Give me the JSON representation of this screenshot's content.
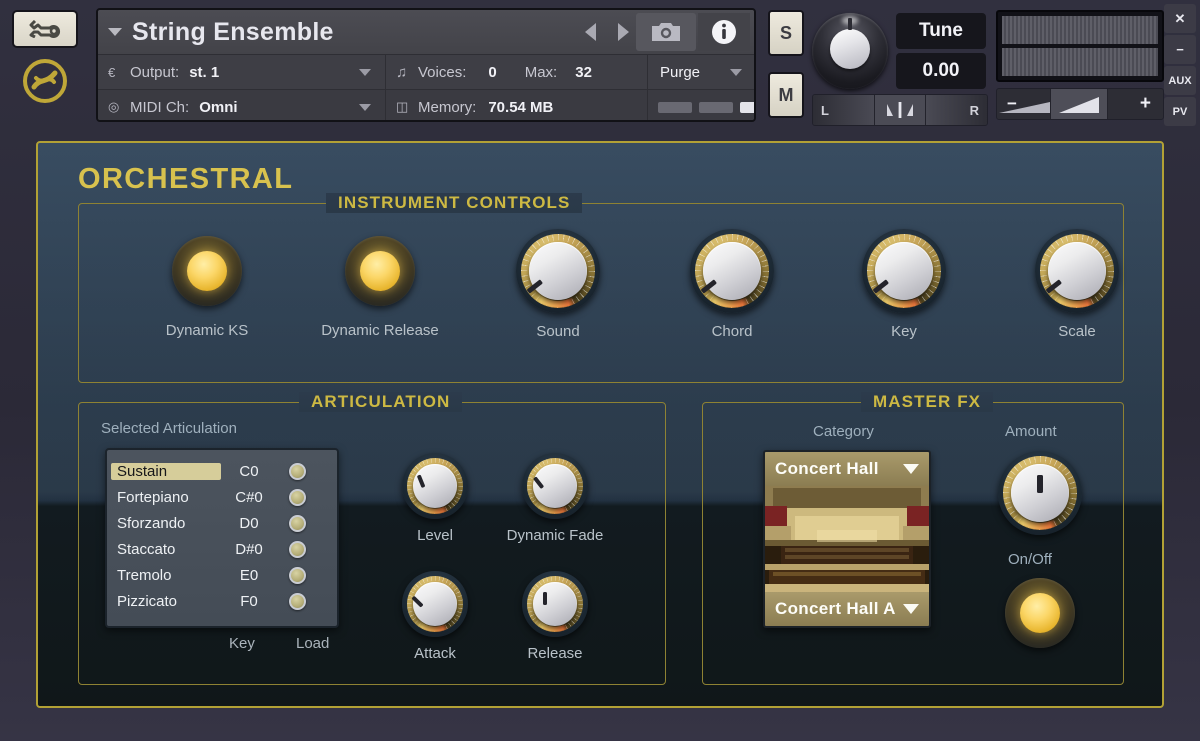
{
  "header": {
    "wrench_icon": "wrench-icon",
    "logo_icon": "native-instruments-logo",
    "instrument_name": "String Ensemble",
    "output_label": "Output:",
    "output_value": "st. 1",
    "midi_label": "MIDI Ch:",
    "midi_value": "Omni",
    "voices_label": "Voices:",
    "voices_value": "0",
    "max_label": "Max:",
    "max_value": "32",
    "memory_label": "Memory:",
    "memory_value": "70.54 MB",
    "purge_label": "Purge",
    "snapshot_icon": "camera-icon",
    "info_icon": "info-icon",
    "prev_icon": "prev-arrow-icon",
    "next_icon": "next-arrow-icon",
    "solo_label": "S",
    "mute_label": "M",
    "tune_label": "Tune",
    "tune_value": "0.00",
    "pan_left": "L",
    "pan_right": "R",
    "vol_minus": "−",
    "vol_plus": "+",
    "edge_buttons": [
      {
        "label": "✕",
        "name": "close-button"
      },
      {
        "label": "−",
        "name": "minimize-button"
      },
      {
        "label": "AUX",
        "name": "aux-button"
      },
      {
        "label": "PV",
        "name": "pv-button"
      }
    ]
  },
  "panel": {
    "brand": "ORCHESTRAL",
    "instrument_controls": {
      "title": "INSTRUMENT CONTROLS",
      "toggles": [
        {
          "label": "Dynamic KS",
          "on": true
        },
        {
          "label": "Dynamic Release",
          "on": true
        }
      ],
      "knobs": [
        {
          "label": "Sound",
          "angle": -128
        },
        {
          "label": "Chord",
          "angle": -128
        },
        {
          "label": "Key",
          "angle": -128
        },
        {
          "label": "Scale",
          "angle": -128
        }
      ]
    },
    "articulation": {
      "title": "ARTICULATION",
      "subtitle": "Selected Articulation",
      "col_key": "Key",
      "col_load": "Load",
      "items": [
        {
          "name": "Sustain",
          "key": "C0",
          "selected": true,
          "loaded": true
        },
        {
          "name": "Fortepiano",
          "key": "C#0",
          "selected": false,
          "loaded": true
        },
        {
          "name": "Sforzando",
          "key": "D0",
          "selected": false,
          "loaded": true
        },
        {
          "name": "Staccato",
          "key": "D#0",
          "selected": false,
          "loaded": true
        },
        {
          "name": "Tremolo",
          "key": "E0",
          "selected": false,
          "loaded": true
        },
        {
          "name": "Pizzicato",
          "key": "F0",
          "selected": false,
          "loaded": true
        }
      ],
      "knobs": [
        {
          "label": "Level",
          "angle": -22
        },
        {
          "label": "Dynamic Fade",
          "angle": -38
        },
        {
          "label": "Attack",
          "angle": -46
        },
        {
          "label": "Release",
          "angle": 0
        }
      ]
    },
    "master_fx": {
      "title": "MASTER FX",
      "category_label": "Category",
      "category_value": "Concert Hall",
      "preset_value": "Concert Hall A",
      "amount_label": "Amount",
      "amount_angle": 0,
      "onoff_label": "On/Off",
      "onoff_on": true,
      "hall_image": "concert-hall-thumbnail"
    }
  },
  "colors": {
    "gold_border": "#b2a135",
    "brand_gold": "#d8c24e",
    "section_title": "#cdb943",
    "led_on": "#fbd667",
    "panel_dark": "#101719",
    "panel_light": "#2b3a4b"
  }
}
